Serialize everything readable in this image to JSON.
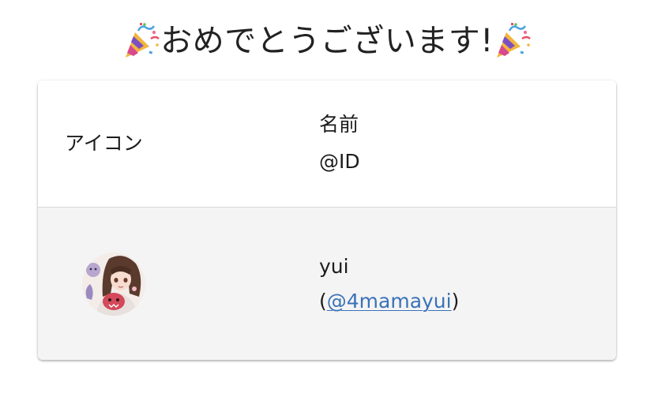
{
  "title": {
    "text": "おめでとうございます!",
    "icon_left": "party-popper-icon",
    "icon_right": "party-popper-icon"
  },
  "table": {
    "headers": {
      "icon": "アイコン",
      "name": "名前",
      "id": "@ID"
    },
    "rows": [
      {
        "avatar": "user-avatar",
        "name": "yui",
        "id_open": "(",
        "id_link": "@4mamayui",
        "id_close": ")"
      }
    ]
  },
  "colors": {
    "link": "#3a72b8",
    "row_background": "#f4f4f4",
    "header_background": "#ffffff"
  }
}
